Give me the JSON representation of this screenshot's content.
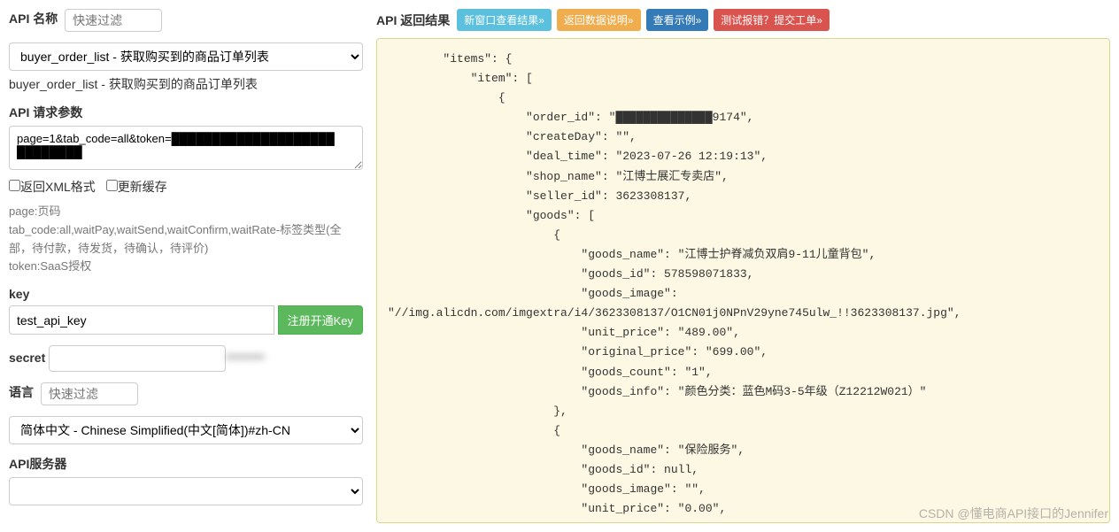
{
  "left": {
    "apiNameLabel": "API 名称",
    "apiNameFilter": "快速过滤",
    "apiSelectValue": "buyer_order_list - 获取购买到的商品订单列表",
    "apiSelectedText": "buyer_order_list - 获取购买到的商品订单列表",
    "paramsLabel": "API 请求参数",
    "paramsValue": "page=1&tab_code=all&token=",
    "cbXmlLabel": "返回XML格式",
    "cbCacheLabel": "更新缓存",
    "help1": "page:页码",
    "help2": "tab_code:all,waitPay,waitSend,waitConfirm,waitRate-标签类型(全部，待付款，待发货，待确认，待评价)",
    "help3": "token:SaaS授权",
    "keyLabel": "key",
    "keyValue": "test_api_key",
    "regKeyLabel": "注册开通Key",
    "secretLabel": "secret",
    "secretValue": "",
    "langLabel": "语言",
    "langFilter": "快速过滤",
    "langSelectValue": "简体中文 - Chinese Simplified(中文[简体])#zh-CN",
    "serverLabel": "API服务器",
    "serverValue": ""
  },
  "right": {
    "title": "API 返回结果",
    "btnNew": "新窗口查看结果»",
    "btnDesc": "返回数据说明»",
    "btnExample": "查看示例»",
    "btnReport": "测试报错？提交工单»"
  },
  "json_display": {
    "order_id_masked": "██████████████9174",
    "createDay": "",
    "deal_time": "2023-07-26 12:19:13",
    "shop_name": "江博士展汇专卖店",
    "seller_id": 3623308137,
    "goods1_name": "江博士护脊减负双肩9-11儿童背包",
    "goods1_id": 578598071833,
    "goods1_image": "//img.alicdn.com/imgextra/i4/3623308137/O1CN01j0NPnV29yne745ulw_!!3623308137.jpg",
    "goods1_unit_price": "489.00",
    "goods1_original_price": "699.00",
    "goods1_count": "1",
    "goods1_info": "颜色分类：蓝色M码3-5年级（Z12212W021）",
    "goods2_name": "保险服务",
    "goods2_unit_price": "0.00"
  },
  "watermark": "CSDN @懂电商API接口的Jennifer"
}
